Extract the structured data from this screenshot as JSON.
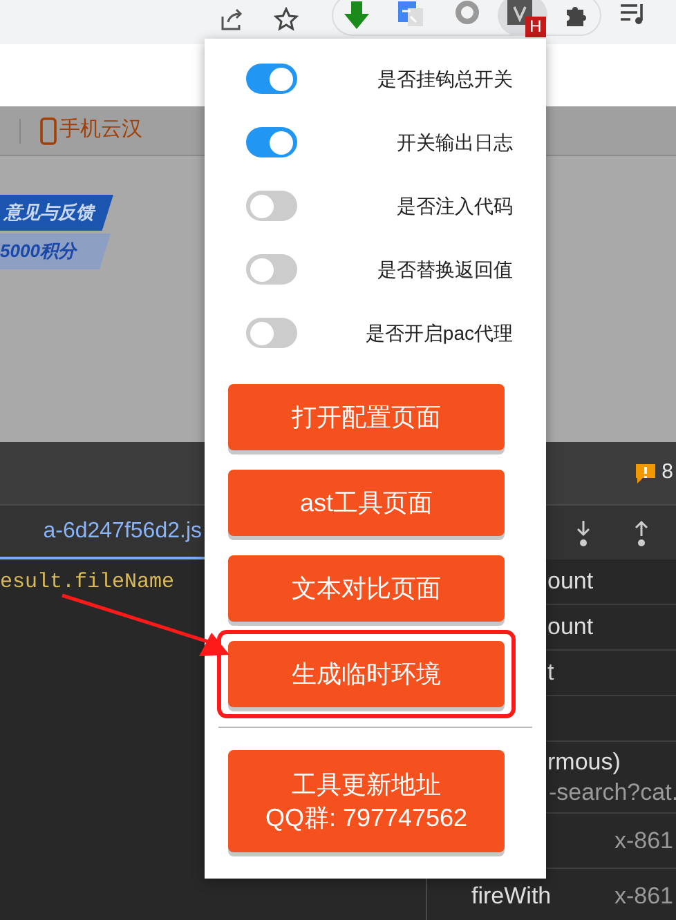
{
  "toolbar": {
    "badge": "H"
  },
  "page": {
    "nav_link": "手机云汉",
    "banner_lines": [
      "意见与反馈",
      "5000积分"
    ]
  },
  "devtools": {
    "warning_count": "8",
    "file_tab": "a-6d247f56d2.js",
    "code": "esult.fileName",
    "rows": [
      {
        "kind": "text",
        "text": "ount"
      },
      {
        "kind": "text",
        "text": "ount"
      },
      {
        "kind": "text",
        "text": "t"
      },
      {
        "kind": "blank"
      },
      {
        "kind": "double",
        "text": "rmous)",
        "subtext": "-search?cat."
      },
      {
        "kind": "value",
        "value": "x-861"
      },
      {
        "kind": "pair",
        "text": "fireWith",
        "value": "x-861"
      }
    ]
  },
  "popup": {
    "toggles": [
      {
        "label": "是否挂钩总开关",
        "on": true
      },
      {
        "label": "开关输出日志",
        "on": true
      },
      {
        "label": "是否注入代码",
        "on": false
      },
      {
        "label": "是否替换返回值",
        "on": false
      },
      {
        "label": "是否开启pac代理",
        "on": false
      }
    ],
    "buttons": [
      {
        "lines": [
          "打开配置页面"
        ],
        "highlighted": false
      },
      {
        "lines": [
          "ast工具页面"
        ],
        "highlighted": false
      },
      {
        "lines": [
          "文本对比页面"
        ],
        "highlighted": false
      },
      {
        "lines": [
          "生成临时环境"
        ],
        "highlighted": true
      }
    ],
    "footer_button": {
      "lines": [
        "工具更新地址",
        "QQ群: 797747562"
      ]
    }
  }
}
